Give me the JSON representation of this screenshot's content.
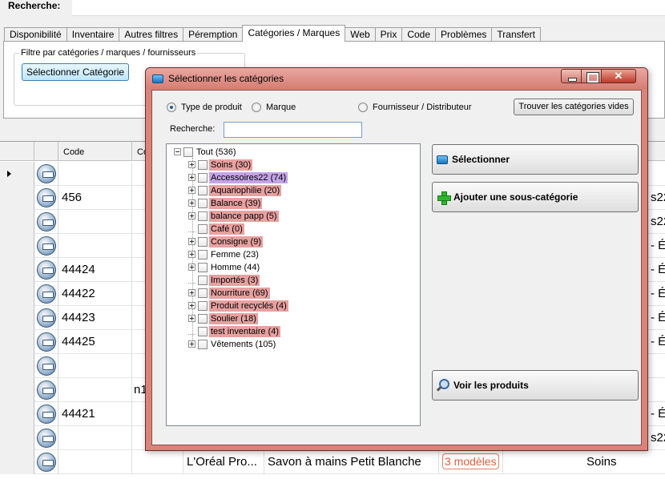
{
  "top": {
    "search_label": "Recherche:"
  },
  "tabs": [
    "Disponibilité",
    "Inventaire",
    "Autres filtres",
    "Péremption",
    "Catégories / Marques",
    "Web",
    "Prix",
    "Code",
    "Problèmes",
    "Transfert"
  ],
  "active_tab": "Catégories / Marques",
  "filter": {
    "legend": "Filtre par catégories / marques / fournisseurs",
    "button": "Sélectionner Catégorie"
  },
  "grid": {
    "headers": [
      "Code",
      "Co"
    ],
    "rows": [
      {
        "code": "",
        "c2": "",
        "edge": ""
      },
      {
        "code": "456",
        "c2": "",
        "edge": "s22"
      },
      {
        "code": "",
        "c2": "",
        "edge": "s22"
      },
      {
        "code": "",
        "c2": "",
        "edge": "- É"
      },
      {
        "code": "44424",
        "c2": "",
        "edge": "- É"
      },
      {
        "code": "44422",
        "c2": "",
        "edge": "- É"
      },
      {
        "code": "44423",
        "c2": "",
        "edge": "- É"
      },
      {
        "code": "44425",
        "c2": "",
        "edge": "- É"
      },
      {
        "code": "",
        "c2": "",
        "edge": ""
      },
      {
        "code": "",
        "c2": "n1",
        "edge": ""
      },
      {
        "code": "44421",
        "c2": "",
        "edge": "- É"
      },
      {
        "code": "",
        "c2": "",
        "edge": "s22"
      },
      {
        "code": "",
        "c2": "",
        "brand": "L'Oréal Pro...",
        "name": "Savon à mains Petit Blanche",
        "models": "3 modèles",
        "cat": "Soins",
        "edge": ""
      }
    ]
  },
  "dialog": {
    "title": "Sélectionner les catégories",
    "radios": [
      "Type de produit",
      "Marque",
      "Fournisseur / Distributeur"
    ],
    "selected_radio": "Type de produit",
    "empty_button": "Trouver les catégories vides",
    "search_label": "Recherche:",
    "search_value": "",
    "root": "Tout (536)",
    "categories": [
      {
        "label": "Soins (30)",
        "hl": "red",
        "exp": true
      },
      {
        "label": "Accessoires22 (74)",
        "hl": "purple",
        "exp": true
      },
      {
        "label": "Aquariophilie (20)",
        "hl": "red",
        "exp": true
      },
      {
        "label": "Balance (39)",
        "hl": "red",
        "exp": true
      },
      {
        "label": "balance papp (5)",
        "hl": "red",
        "exp": true
      },
      {
        "label": "Café (0)",
        "hl": "red",
        "exp": false
      },
      {
        "label": "Consigne (9)",
        "hl": "red",
        "exp": true
      },
      {
        "label": "Femme (23)",
        "hl": "",
        "exp": true
      },
      {
        "label": "Homme (44)",
        "hl": "",
        "exp": true
      },
      {
        "label": "Importés (3)",
        "hl": "red",
        "exp": false
      },
      {
        "label": "Nourriture (69)",
        "hl": "red",
        "exp": true
      },
      {
        "label": "Produit recyclés (4)",
        "hl": "red",
        "exp": true
      },
      {
        "label": "Soulier (18)",
        "hl": "red",
        "exp": true
      },
      {
        "label": "test inventaire (4)",
        "hl": "red",
        "exp": false
      },
      {
        "label": "Vêtements (105)",
        "hl": "",
        "exp": true
      }
    ],
    "btn_select": "Sélectionner",
    "btn_add": "Ajouter une sous-catégorie",
    "btn_view": "Voir les produits",
    "colors": {
      "title_bar": "#d67e74",
      "highlight_red": "#e8a0a0",
      "highlight_purple": "#c4a4e8"
    }
  }
}
